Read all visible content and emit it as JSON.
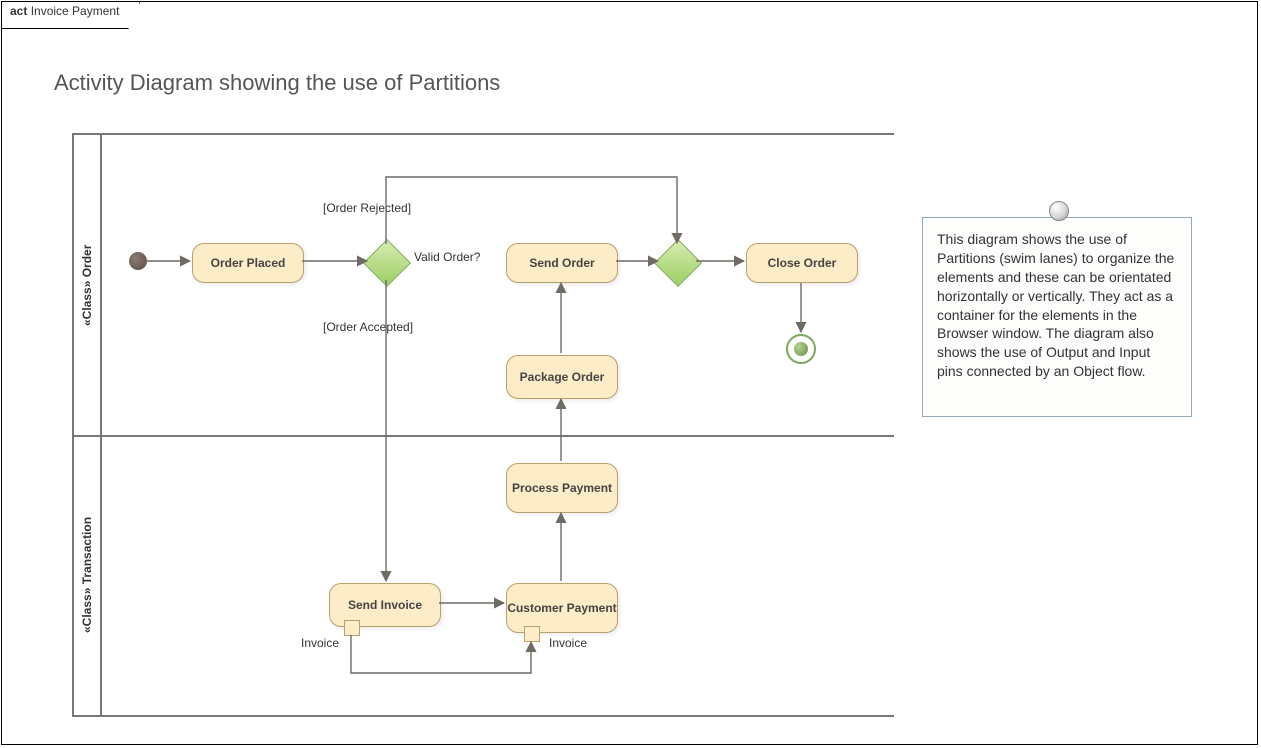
{
  "frame": {
    "type_label": "act",
    "name": "Invoice Payment"
  },
  "title": "Activity Diagram showing the use of Partitions",
  "lanes": [
    {
      "label": "«Class» Order"
    },
    {
      "label": "«Class» Transaction"
    }
  ],
  "activities": {
    "order_placed": "Order Placed",
    "send_order": "Send Order",
    "close_order": "Close Order",
    "package_order": "Package Order",
    "process_payment": "Process Payment",
    "send_invoice": "Send Invoice",
    "customer_payment": "Customer Payment"
  },
  "decisions": {
    "valid_order_label": "Valid Order?"
  },
  "guards": {
    "order_rejected": "[Order Rejected]",
    "order_accepted": "[Order Accepted]"
  },
  "pins": {
    "invoice_out": "Invoice",
    "invoice_in": "Invoice"
  },
  "note": {
    "text": "This diagram shows the use of Partitions (swim lanes) to organize the elements and these can be orientated horizontally or vertically. They act as a container for the elements in the Browser window. The diagram also shows the use of Output and Input pins connected by an Object flow."
  },
  "chart_data": {
    "type": "activity-diagram",
    "partitions": [
      "«Class» Order",
      "«Class» Transaction"
    ],
    "nodes": [
      {
        "id": "start",
        "type": "initial",
        "partition": 0
      },
      {
        "id": "order_placed",
        "type": "activity",
        "label": "Order Placed",
        "partition": 0
      },
      {
        "id": "valid_order",
        "type": "decision",
        "label": "Valid Order?",
        "partition": 0
      },
      {
        "id": "send_order",
        "type": "activity",
        "label": "Send Order",
        "partition": 0
      },
      {
        "id": "merge",
        "type": "merge",
        "partition": 0
      },
      {
        "id": "close_order",
        "type": "activity",
        "label": "Close Order",
        "partition": 0
      },
      {
        "id": "final",
        "type": "final",
        "partition": 0
      },
      {
        "id": "package_order",
        "type": "activity",
        "label": "Package Order",
        "partition": 0
      },
      {
        "id": "process_payment",
        "type": "activity",
        "label": "Process Payment",
        "partition": 1
      },
      {
        "id": "send_invoice",
        "type": "activity",
        "label": "Send Invoice",
        "partition": 1
      },
      {
        "id": "customer_payment",
        "type": "activity",
        "label": "Customer Payment",
        "partition": 1
      }
    ],
    "edges": [
      {
        "from": "start",
        "to": "order_placed"
      },
      {
        "from": "order_placed",
        "to": "valid_order"
      },
      {
        "from": "valid_order",
        "to": "merge",
        "guard": "[Order Rejected]"
      },
      {
        "from": "valid_order",
        "to": "send_invoice",
        "guard": "[Order Accepted]"
      },
      {
        "from": "send_invoice",
        "to": "customer_payment",
        "object": "Invoice"
      },
      {
        "from": "customer_payment",
        "to": "process_payment"
      },
      {
        "from": "process_payment",
        "to": "package_order"
      },
      {
        "from": "package_order",
        "to": "send_order"
      },
      {
        "from": "send_order",
        "to": "merge"
      },
      {
        "from": "merge",
        "to": "close_order"
      },
      {
        "from": "close_order",
        "to": "final"
      }
    ]
  }
}
